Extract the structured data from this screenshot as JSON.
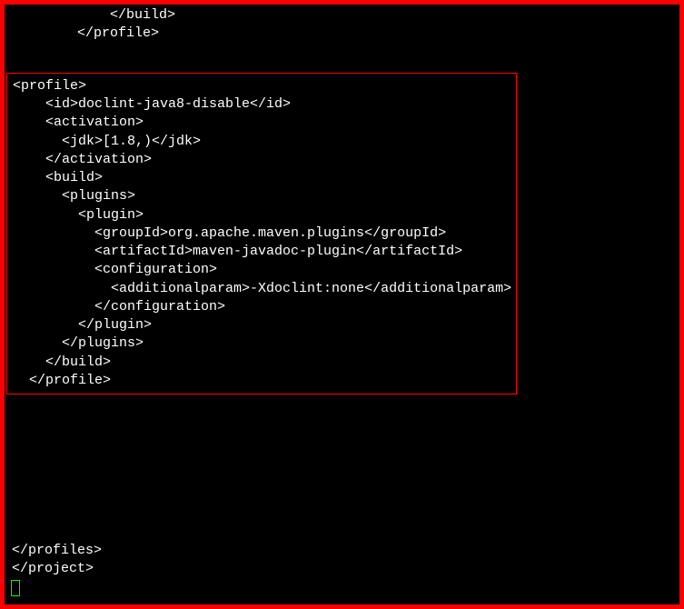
{
  "top_fragment": {
    "build_close": "            </build>",
    "profile_close": "        </profile>"
  },
  "highlighted_block": {
    "lines": [
      "<profile>",
      "    <id>doclint-java8-disable</id>",
      "    <activation>",
      "      <jdk>[1.8,)</jdk>",
      "    </activation>",
      "    <build>",
      "      <plugins>",
      "        <plugin>",
      "          <groupId>org.apache.maven.plugins</groupId>",
      "          <artifactId>maven-javadoc-plugin</artifactId>",
      "          <configuration>",
      "            <additionalparam>-Xdoclint:none</additionalparam>",
      "          </configuration>",
      "        </plugin>",
      "      </plugins>",
      "    </build>",
      "  </profile>"
    ]
  },
  "bottom_fragment": {
    "profiles_close": "</profiles>",
    "blank": "",
    "project_close": "</project>"
  }
}
